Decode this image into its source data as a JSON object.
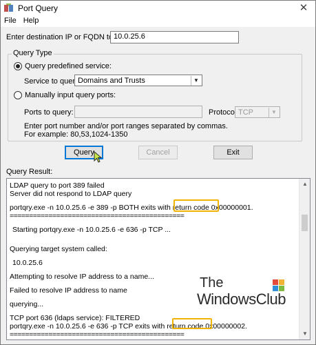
{
  "window": {
    "title": "Port Query",
    "close_glyph": "✕",
    "icon": "port-query-app-icon"
  },
  "menu": [
    {
      "label": "File"
    },
    {
      "label": "Help"
    }
  ],
  "destination": {
    "label": "Enter destination IP or FQDN to query:",
    "value": "10.0.25.6"
  },
  "query_type": {
    "group_title": "Query Type",
    "predefined_label": "Query predefined service:",
    "predefined_selected": true,
    "service_label": "Service to query:",
    "service_value": "Domains and Trusts",
    "manual_label": "Manually input query ports:",
    "manual_selected": false,
    "ports_label": "Ports to query:",
    "ports_value": "",
    "protocol_label": "Protocol:",
    "protocol_value": "TCP",
    "hint_line1": "Enter port number and/or port ranges separated by commas.",
    "hint_line2": "For example: 80,53,1024-1350"
  },
  "buttons": {
    "query": "Query",
    "cancel": "Cancel",
    "exit": "Exit"
  },
  "result": {
    "label": "Query Result:",
    "lines": [
      "LDAP query to port 389 failed",
      "Server did not respond to LDAP query",
      "portqry.exe -n 10.0.25.6 -e 389 -p BOTH exits with return code 0x00000001.",
      "=============================================",
      "Starting portqry.exe -n 10.0.25.6 -e 636 -p TCP ...",
      "Querying target system called:",
      "10.0.25.6",
      "Attempting to resolve IP address to a name...",
      "Failed to resolve IP address to name",
      "querying...",
      "TCP port 636 (ldaps service): FILTERED",
      "portqry.exe -n 10.0.25.6 -e 636 -p TCP exits with return code 0x00000002.",
      "============================================="
    ]
  },
  "watermark": {
    "line1": "The",
    "line2": "WindowsClub"
  },
  "colors": {
    "highlight": "#f0b400",
    "default_button_border": "#0078d7"
  }
}
